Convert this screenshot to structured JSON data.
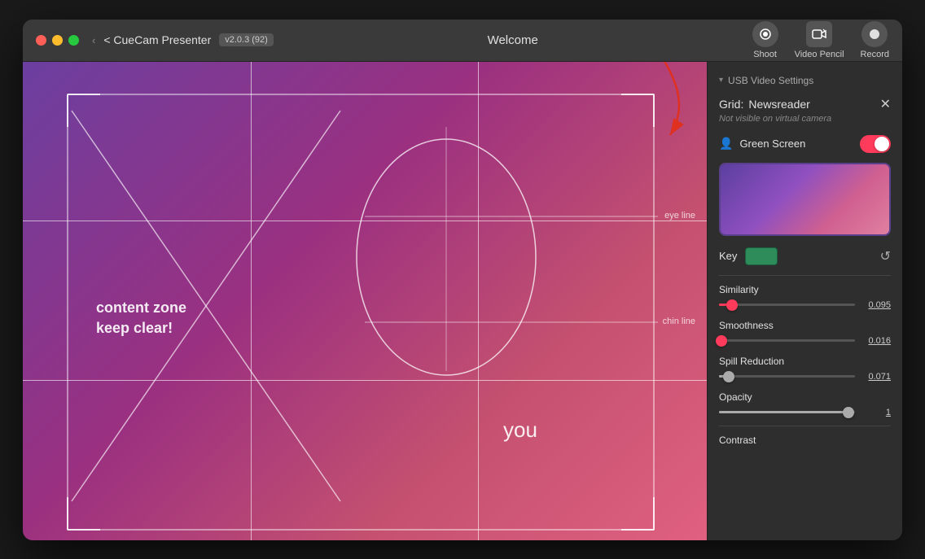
{
  "window": {
    "title": "CueCam Presenter",
    "version": "v2.0.3 (92)",
    "tab": "Welcome"
  },
  "titlebar": {
    "back_label": "< CueCam Presenter",
    "version_label": "v2.0.3 (92)",
    "center_label": "Welcome",
    "shoot_label": "Shoot",
    "video_pencil_label": "Video Pencil",
    "record_label": "Record"
  },
  "side_panel": {
    "section_header": "USB Video Settings",
    "grid_label": "Grid:",
    "grid_value": "Newsreader",
    "not_visible": "Not visible on virtual camera",
    "green_screen_label": "Green Screen",
    "key_label": "Key",
    "similarity_label": "Similarity",
    "similarity_value": "0.095",
    "smoothness_label": "Smoothness",
    "smoothness_value": "0.016",
    "spill_reduction_label": "Spill Reduction",
    "spill_reduction_value": "0.071",
    "opacity_label": "Opacity",
    "opacity_value": "1",
    "contrast_label": "Contrast"
  },
  "video": {
    "eye_line_label": "eye line",
    "chin_line_label": "chin line",
    "content_zone_line1": "content zone",
    "content_zone_line2": "keep clear!",
    "you_label": "you"
  },
  "sliders": {
    "similarity_pct": 9.5,
    "smoothness_pct": 1.6,
    "spill_pct": 7.1,
    "opacity_pct": 95
  }
}
